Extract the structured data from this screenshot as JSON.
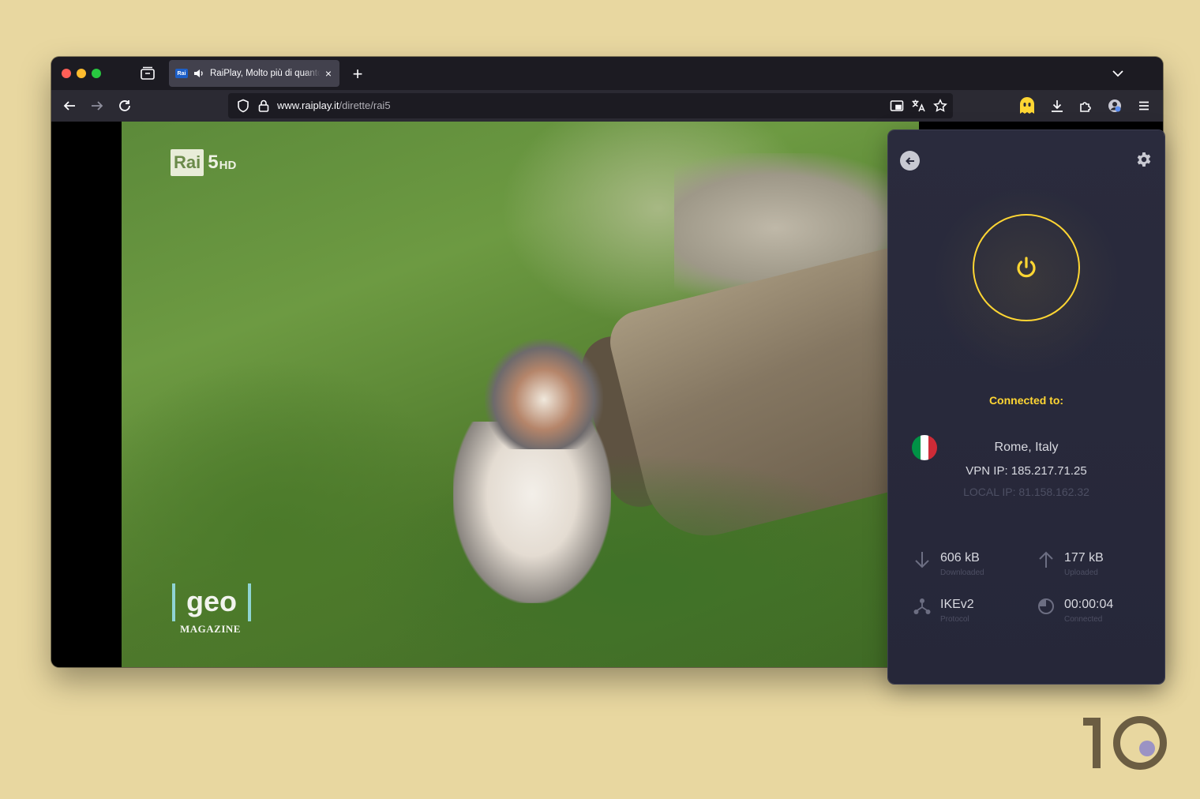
{
  "browser": {
    "tab": {
      "favicon_text": "Rai",
      "title": "RaiPlay, Molto più di quanto immagini",
      "close_label": "×"
    },
    "new_tab_label": "+",
    "url": {
      "host": "www.raiplay.it",
      "path": "/dirette/rai5"
    }
  },
  "video": {
    "channel_logo": "Rai",
    "channel_number": "5",
    "channel_quality": "HD",
    "show_logo_word": "geo",
    "show_logo_subtitle": "MAGAZINE"
  },
  "vpn": {
    "connected_label": "Connected to:",
    "location": "Rome, Italy",
    "vpn_ip": "VPN IP: 185.217.71.25",
    "local_ip": "LOCAL IP: 81.158.162.32",
    "flag_colors": [
      "#009246",
      "#ffffff",
      "#ce2b37"
    ],
    "accent_color": "#ffd633",
    "stats": {
      "downloaded": {
        "value": "606 kB",
        "label": "Downloaded",
        "icon": "arrow-down-icon"
      },
      "uploaded": {
        "value": "177 kB",
        "label": "Uploaded",
        "icon": "arrow-up-icon"
      },
      "protocol": {
        "value": "IKEv2",
        "label": "Protocol",
        "icon": "network-icon"
      },
      "connected": {
        "value": "00:00:04",
        "label": "Connected",
        "icon": "timer-icon"
      }
    }
  },
  "brand": {
    "digit": "1",
    "colors": {
      "ring": "#6b5d42",
      "dot": "#9b93c4"
    }
  }
}
